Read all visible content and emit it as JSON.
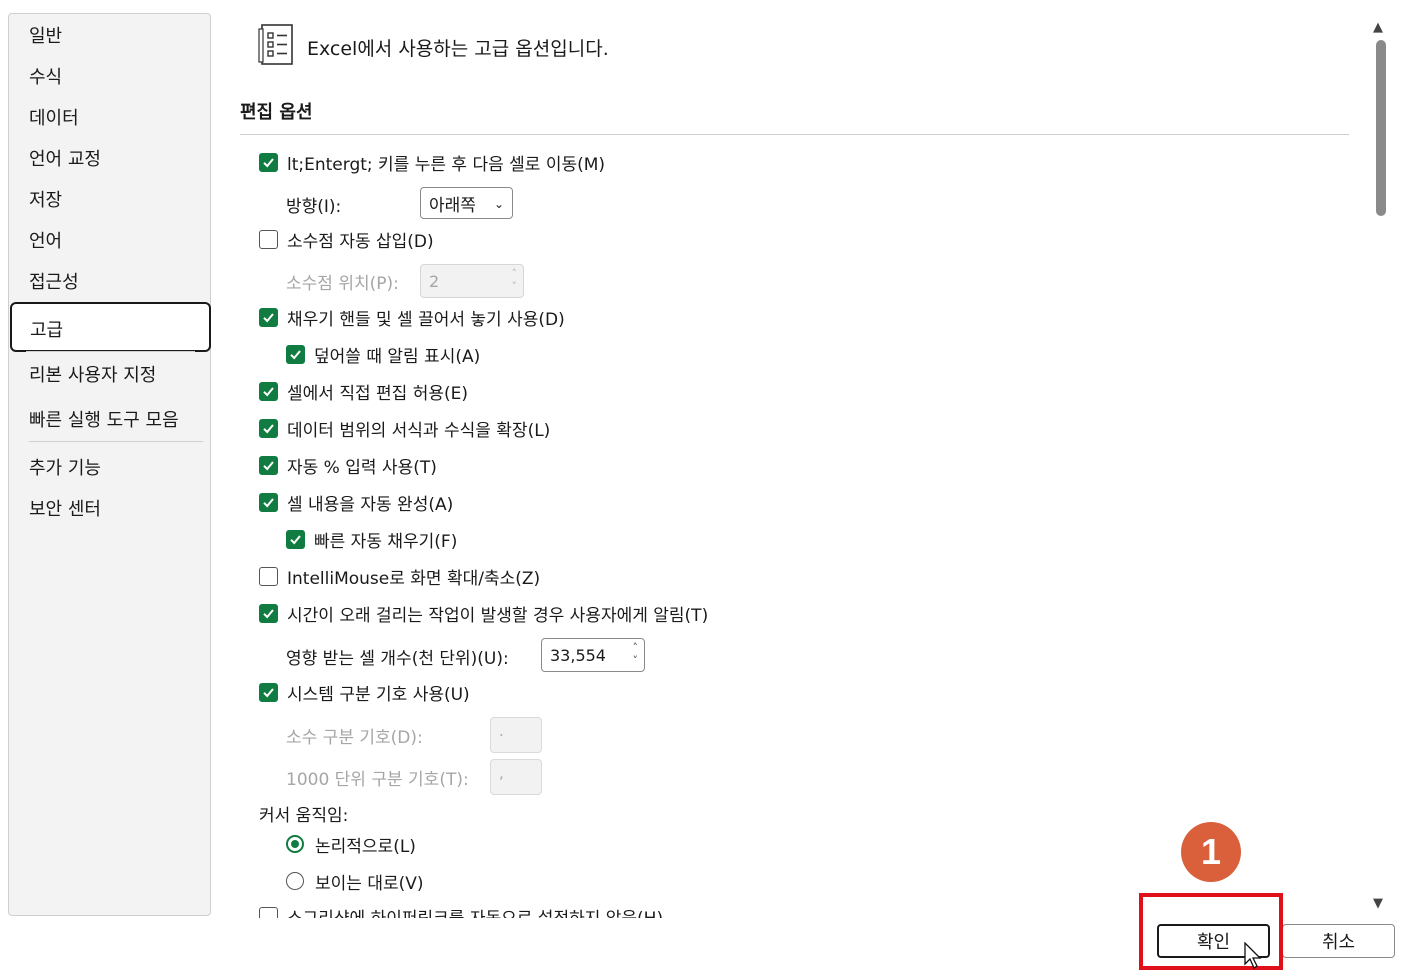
{
  "sidebar": {
    "items": [
      {
        "label": "일반"
      },
      {
        "label": "수식"
      },
      {
        "label": "데이터"
      },
      {
        "label": "언어 교정"
      },
      {
        "label": "저장"
      },
      {
        "label": "언어"
      },
      {
        "label": "접근성"
      },
      {
        "label": "고급",
        "selected": true
      },
      {
        "label": "리본 사용자 지정"
      },
      {
        "label": "빠른 실행 도구 모음"
      },
      {
        "label": "추가 기능"
      },
      {
        "label": "보안 센터"
      }
    ]
  },
  "header": {
    "icon": "list-settings-icon",
    "text": "Excel에서 사용하는 고급 옵션입니다."
  },
  "section": {
    "title": "편집 옵션"
  },
  "options": {
    "enter_move": {
      "label": "lt;Entergt; 키를 누른 후 다음 셀로 이동(M)",
      "checked": true
    },
    "direction_label": "방향(I):",
    "direction_value": "아래쪽",
    "decimal_insert": {
      "label": "소수점 자동 삽입(D)",
      "checked": false
    },
    "decimal_places_label": "소수점 위치(P):",
    "decimal_places_value": "2",
    "fill_handle": {
      "label": "채우기 핸들 및 셀 끌어서 놓기 사용(D)",
      "checked": true
    },
    "overwrite_alert": {
      "label": "덮어쓸 때 알림 표시(A)",
      "checked": true
    },
    "edit_in_cell": {
      "label": "셀에서 직접 편집 허용(E)",
      "checked": true
    },
    "extend_formats": {
      "label": "데이터 범위의 서식과 수식을 확장(L)",
      "checked": true
    },
    "auto_percent": {
      "label": "자동 % 입력 사용(T)",
      "checked": true
    },
    "autocomplete": {
      "label": "셀 내용을 자동 완성(A)",
      "checked": true
    },
    "flash_fill": {
      "label": "빠른 자동 채우기(F)",
      "checked": true
    },
    "intellimouse": {
      "label": "IntelliMouse로 화면 확대/축소(Z)",
      "checked": false
    },
    "long_op_alert": {
      "label": "시간이 오래 걸리는 작업이 발생할 경우 사용자에게 알림(T)",
      "checked": true
    },
    "affected_cells_label": "영향 받는 셀 개수(천 단위)(U):",
    "affected_cells_value": "33,554",
    "system_separators": {
      "label": "시스템 구분 기호 사용(U)",
      "checked": true
    },
    "decimal_sep_label": "소수 구분 기호(D):",
    "decimal_sep_value": ".",
    "thousands_sep_label": "1000 단위 구분 기호(T):",
    "thousands_sep_value": ",",
    "cursor_movement_label": "커서 움직임:",
    "logical": {
      "label": "논리적으로(L)",
      "selected": true
    },
    "visual": {
      "label": "보이는 대로(V)",
      "selected": false
    },
    "cutoff": {
      "label": "소그리샷에 하이퍼링크를 자동으로 설정하지 않음(H)",
      "checked": false
    }
  },
  "footer": {
    "ok_label": "확인",
    "cancel_label": "취소"
  },
  "annotation": {
    "badge_number": "1",
    "highlight_color": "#e0101a",
    "badge_color": "#d9603b"
  },
  "colors": {
    "accent": "#107c41"
  }
}
